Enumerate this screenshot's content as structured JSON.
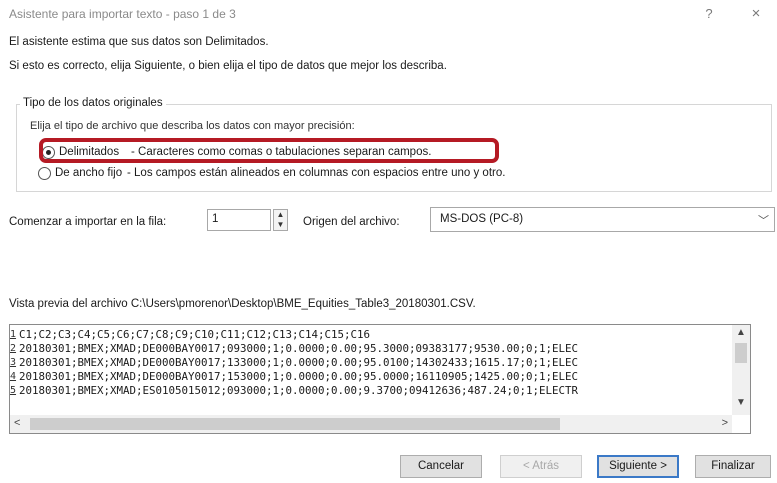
{
  "window": {
    "title": "Asistente para importar texto - paso 1 de 3",
    "help_label": "?",
    "close_label": "×"
  },
  "intro": {
    "line1": "El asistente estima que sus datos son Delimitados.",
    "line2": "Si esto es correcto, elija Siguiente, o bien elija el tipo de datos que mejor los describa."
  },
  "data_type": {
    "group_title": "Tipo de los datos originales",
    "prompt": "Elija el tipo de archivo que describa los datos con mayor precisión:",
    "options": [
      {
        "label": "Delimitados",
        "description": "- Caracteres como comas o tabulaciones separan campos.",
        "selected": true
      },
      {
        "label": "De ancho fijo",
        "description": "- Los campos están alineados en columnas con espacios entre uno y otro.",
        "selected": false
      }
    ]
  },
  "import_row": {
    "label": "Comenzar a importar en la fila:",
    "value": "1"
  },
  "origin": {
    "label": "Origen del archivo:",
    "value": "MS-DOS (PC-8)"
  },
  "preview": {
    "label": "Vista previa del archivo C:\\Users\\pmorenor\\Desktop\\BME_Equities_Table3_20180301.CSV.",
    "rows": [
      {
        "num": "1",
        "text": "C1;C2;C3;C4;C5;C6;C7;C8;C9;C10;C11;C12;C13;C14;C15;C16"
      },
      {
        "num": "2",
        "text": "20180301;BMEX;XMAD;DE000BAY0017;093000;1;0.0000;0.00;95.3000;09383177;9530.00;0;1;ELEC"
      },
      {
        "num": "3",
        "text": "20180301;BMEX;XMAD;DE000BAY0017;133000;1;0.0000;0.00;95.0100;14302433;1615.17;0;1;ELEC"
      },
      {
        "num": "4",
        "text": "20180301;BMEX;XMAD;DE000BAY0017;153000;1;0.0000;0.00;95.0000;16110905;1425.00;0;1;ELEC"
      },
      {
        "num": "5",
        "text": "20180301;BMEX;XMAD;ES0105015012;093000;1;0.0000;0.00;9.3700;09412636;487.24;0;1;ELECTR"
      }
    ]
  },
  "buttons": {
    "cancel": "Cancelar",
    "back": "< Atrás",
    "next": "Siguiente >",
    "finish": "Finalizar"
  },
  "icons": {
    "spinner_up": "▲",
    "spinner_down": "▼",
    "dropdown": "﹀",
    "scroll_up": "▲",
    "scroll_down": "▼",
    "scroll_left": "<",
    "scroll_right": ">"
  },
  "colors": {
    "highlight": "#b51a24",
    "default_button_border": "#3b79c7"
  }
}
